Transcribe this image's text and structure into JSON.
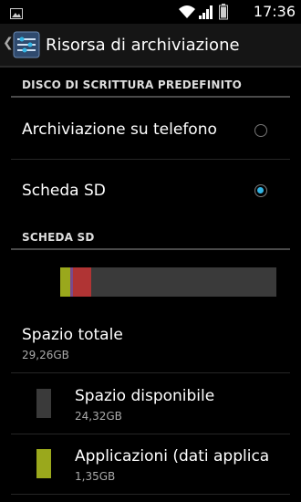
{
  "status_bar": {
    "time": "17:36",
    "icons": [
      "picture-icon",
      "wifi-icon",
      "signal-icon",
      "battery-icon"
    ]
  },
  "action_bar": {
    "title": "Risorsa di archiviazione",
    "icon": "storage-settings-icon"
  },
  "default_write_disk": {
    "header": "DISCO DI SCRITTURA PREDEFINITO",
    "options": [
      {
        "label": "Archiviazione su telefono",
        "selected": false
      },
      {
        "label": "Scheda SD",
        "selected": true
      }
    ]
  },
  "sd_card": {
    "header": "SCHEDA SD",
    "usage": [
      {
        "name": "apps",
        "color": "#9aa81c",
        "fraction": 0.046
      },
      {
        "name": "pictures",
        "color": "#7a4a8c",
        "fraction": 0.013
      },
      {
        "name": "audio",
        "color": "#b03434",
        "fraction": 0.085
      },
      {
        "name": "free",
        "color": "#3a3a3a",
        "fraction": 0.856
      }
    ],
    "total": {
      "label": "Spazio totale",
      "value": "29,26GB"
    },
    "categories": [
      {
        "label": "Spazio disponibile",
        "value": "24,32GB",
        "color": "#3a3a3a"
      },
      {
        "label": "Applicazioni (dati applica",
        "value": "1,35GB",
        "color": "#9aa81c"
      }
    ]
  },
  "colors": {
    "accent": "#33b5e5",
    "background": "#000000",
    "action_bar": "#151515"
  }
}
